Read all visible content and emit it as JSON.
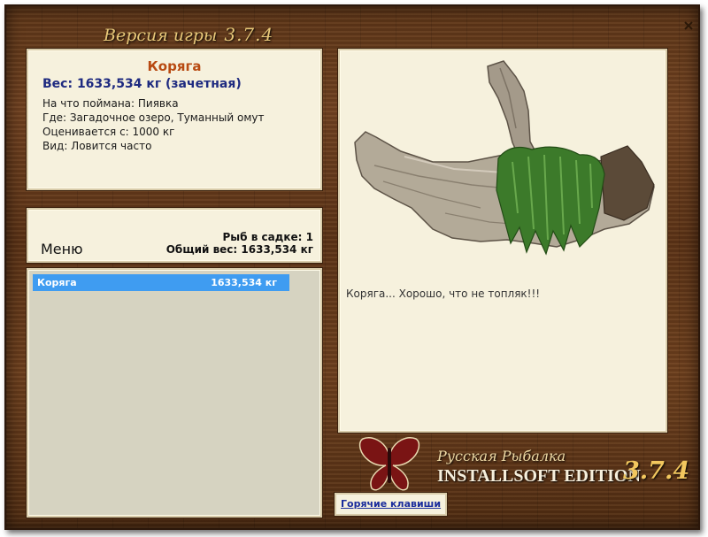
{
  "header": {
    "version_label": "Версия игры",
    "version_number": "3.7.4"
  },
  "catch_info": {
    "title": "Коряга",
    "weight": "Вес: 1633,534 кг (зачетная)",
    "lines": [
      "На что поймана: Пиявка",
      "Где: Загадочное озеро, Туманный омут",
      "Оценивается с: 1000 кг",
      "Вид: Ловится часто"
    ]
  },
  "summary": {
    "menu_label": "Меню",
    "fish_count": "Рыб в садке: 1",
    "total_weight": "Общий вес: 1633,534 кг"
  },
  "catch_list": [
    {
      "name": "Коряга",
      "weight": "1633,534 кг"
    }
  ],
  "preview": {
    "image_icon": "driftwood-image",
    "caption": "Коряга... Хорошо, что не топляк!!!"
  },
  "branding": {
    "logo_icon": "butterfly-icon",
    "subtitle": "Русская Рыбалка",
    "edition": "INSTALLSOFT EDITION",
    "edition_number": "3.7.4"
  },
  "hotkeys_label": "Горячие клавиши",
  "close_icon": "close-icon",
  "colors": {
    "selection": "#3f9cf1",
    "title_accent": "#b84a12",
    "weight_accent": "#1e2a80",
    "logo_red": "#7a1414"
  }
}
